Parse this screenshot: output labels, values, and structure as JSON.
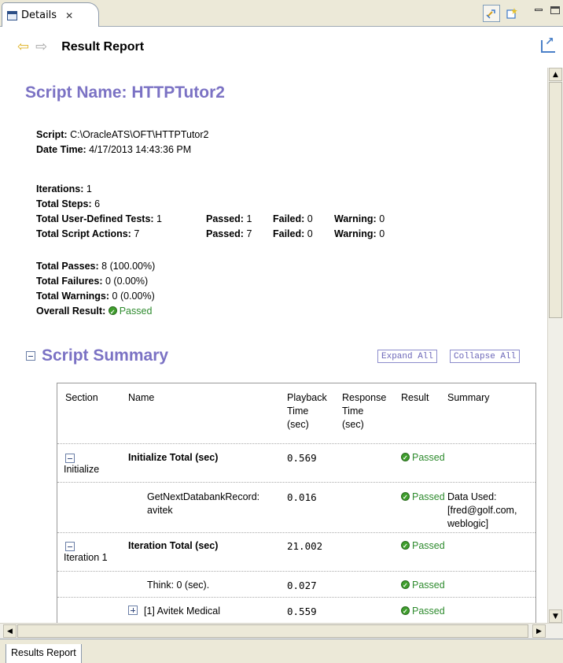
{
  "tab": {
    "label": "Details",
    "close": "✕"
  },
  "header": {
    "title": "Result Report",
    "back": "⇦",
    "forward": "⇨"
  },
  "report": {
    "script_name_title": "Script Name: HTTPTutor2",
    "script_label": "Script:",
    "script_value": "C:\\OracleATS\\OFT\\HTTPTutor2",
    "datetime_label": "Date Time:",
    "datetime_value": "4/17/2013 14:43:36 PM",
    "iterations_label": "Iterations:",
    "iterations_value": "1",
    "total_steps_label": "Total Steps:",
    "total_steps_value": "6",
    "udt_label": "Total User-Defined Tests:",
    "udt_value": "1",
    "udt_passed_label": "Passed:",
    "udt_passed_value": "1",
    "udt_failed_label": "Failed:",
    "udt_failed_value": "0",
    "udt_warning_label": "Warning:",
    "udt_warning_value": "0",
    "actions_label": "Total Script Actions:",
    "actions_value": "7",
    "actions_passed_label": "Passed:",
    "actions_passed_value": "7",
    "actions_failed_label": "Failed:",
    "actions_failed_value": "0",
    "actions_warning_label": "Warning:",
    "actions_warning_value": "0",
    "passes_label": "Total Passes:",
    "passes_value": "8 (100.00%)",
    "failures_label": "Total Failures:",
    "failures_value": "0 (0.00%)",
    "warnings_label": "Total Warnings:",
    "warnings_value": "0 (0.00%)",
    "overall_label": "Overall Result:",
    "overall_value": "Passed"
  },
  "summary": {
    "title": "Script Summary",
    "expand_all": "Expand All",
    "collapse_all": "Collapse All",
    "columns": {
      "section": "Section",
      "name": "Name",
      "playback_l1": "Playback",
      "playback_l2": "Time",
      "playback_l3": "(sec)",
      "response_l1": "Response",
      "response_l2": "Time",
      "response_l3": "(sec)",
      "result": "Result",
      "summary": "Summary"
    },
    "rows": [
      {
        "section": "Initialize",
        "name": "Initialize Total (sec)",
        "playback": "0.569",
        "result": "Passed",
        "summary": ""
      },
      {
        "section": "",
        "name_l1": "GetNextDatabankRecord:",
        "name_l2": "avitek",
        "playback": "0.016",
        "result": "Passed",
        "summary_l1": "Data Used:",
        "summary_l2": "[fred@golf.com,",
        "summary_l3": "weblogic]"
      },
      {
        "section": "Iteration 1",
        "name": "Iteration Total (sec)",
        "playback": "21.002",
        "result": "Passed",
        "summary": ""
      },
      {
        "section": "",
        "name": "Think: 0 (sec).",
        "playback": "0.027",
        "result": "Passed",
        "summary": ""
      },
      {
        "section": "",
        "name": "[1] Avitek Medical",
        "playback": "0.559",
        "result": "Passed",
        "summary": ""
      }
    ]
  },
  "bottom_tab": {
    "label": "Results Report"
  },
  "colors": {
    "heading": "#7b72c4",
    "pass": "#2e8b2e"
  }
}
